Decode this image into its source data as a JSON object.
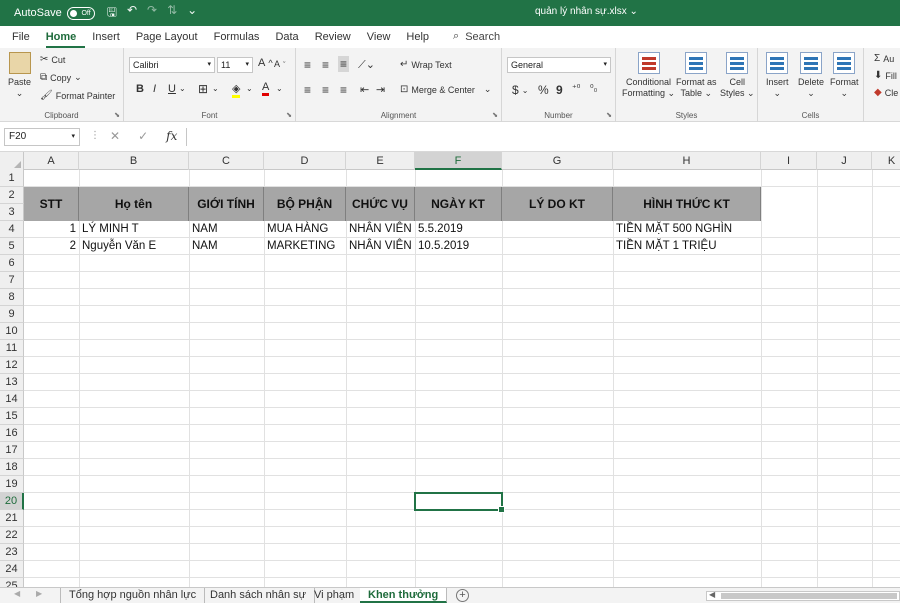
{
  "titlebar": {
    "autosave_label": "AutoSave",
    "autosave_state": "Off",
    "document_title": "quản lý nhân sự.xlsx"
  },
  "menu": {
    "tabs": [
      "File",
      "Home",
      "Insert",
      "Page Layout",
      "Formulas",
      "Data",
      "Review",
      "View",
      "Help"
    ],
    "active": "Home",
    "search_label": "Search"
  },
  "ribbon": {
    "clipboard": {
      "paste": "Paste",
      "cut": "Cut",
      "copy": "Copy",
      "format_painter": "Format Painter",
      "label": "Clipboard"
    },
    "font": {
      "name": "Calibri",
      "size": "11",
      "bold": "B",
      "italic": "I",
      "underline": "U",
      "label": "Font"
    },
    "alignment": {
      "wrap_text": "Wrap Text",
      "merge_center": "Merge & Center",
      "label": "Alignment"
    },
    "number": {
      "format": "General",
      "currency": "$",
      "percent": "%",
      "comma": "9",
      "label": "Number"
    },
    "styles": {
      "conditional_1": "Conditional",
      "conditional_2": "Formatting",
      "format_as_1": "Format as",
      "format_as_2": "Table",
      "cell_styles_1": "Cell",
      "cell_styles_2": "Styles",
      "label": "Styles"
    },
    "cells": {
      "insert": "Insert",
      "delete": "Delete",
      "format": "Format",
      "label": "Cells"
    },
    "editing": {
      "autosum": "Au",
      "fill": "Fill",
      "clear": "Cle"
    }
  },
  "formula_bar": {
    "name_box": "F20",
    "cancel": "✕",
    "enter": "✓",
    "fx": "fx",
    "value": ""
  },
  "columns": [
    "A",
    "B",
    "C",
    "D",
    "E",
    "F",
    "G",
    "H",
    "I",
    "J",
    "K"
  ],
  "selected_column": "F",
  "rows": [
    "1",
    "2",
    "3",
    "4",
    "5",
    "6",
    "7",
    "8",
    "9",
    "10",
    "11",
    "12",
    "13",
    "14",
    "15",
    "16",
    "17",
    "18",
    "19",
    "20",
    "21",
    "22",
    "23",
    "24",
    "25"
  ],
  "selected_row": "20",
  "table": {
    "headers": [
      "STT",
      "Họ tên",
      "GIỚI TÍNH",
      "BỘ PHẬN",
      "CHỨC VỤ",
      "NGÀY KT",
      "LÝ DO KT",
      "HÌNH THỨC KT"
    ],
    "rows": [
      [
        "1",
        "LÝ MINH T",
        "NAM",
        "MUA HÀNG",
        "NHÂN VIÊN",
        "5.5.2019",
        "",
        "TIỀN MẶT 500 NGHÌN"
      ],
      [
        "2",
        "Nguyễn Văn E",
        "NAM",
        "MARKETING",
        "NHÂN VIÊN",
        "10.5.2019",
        "",
        "TIỀN MẶT 1 TRIỆU"
      ]
    ]
  },
  "sheets": [
    "Tổng hợp nguồn nhân lực",
    "Danh sách nhân sự",
    "Vi phạm",
    "Khen thưởng"
  ],
  "active_sheet": "Khen thưởng",
  "add_sheet": "+"
}
